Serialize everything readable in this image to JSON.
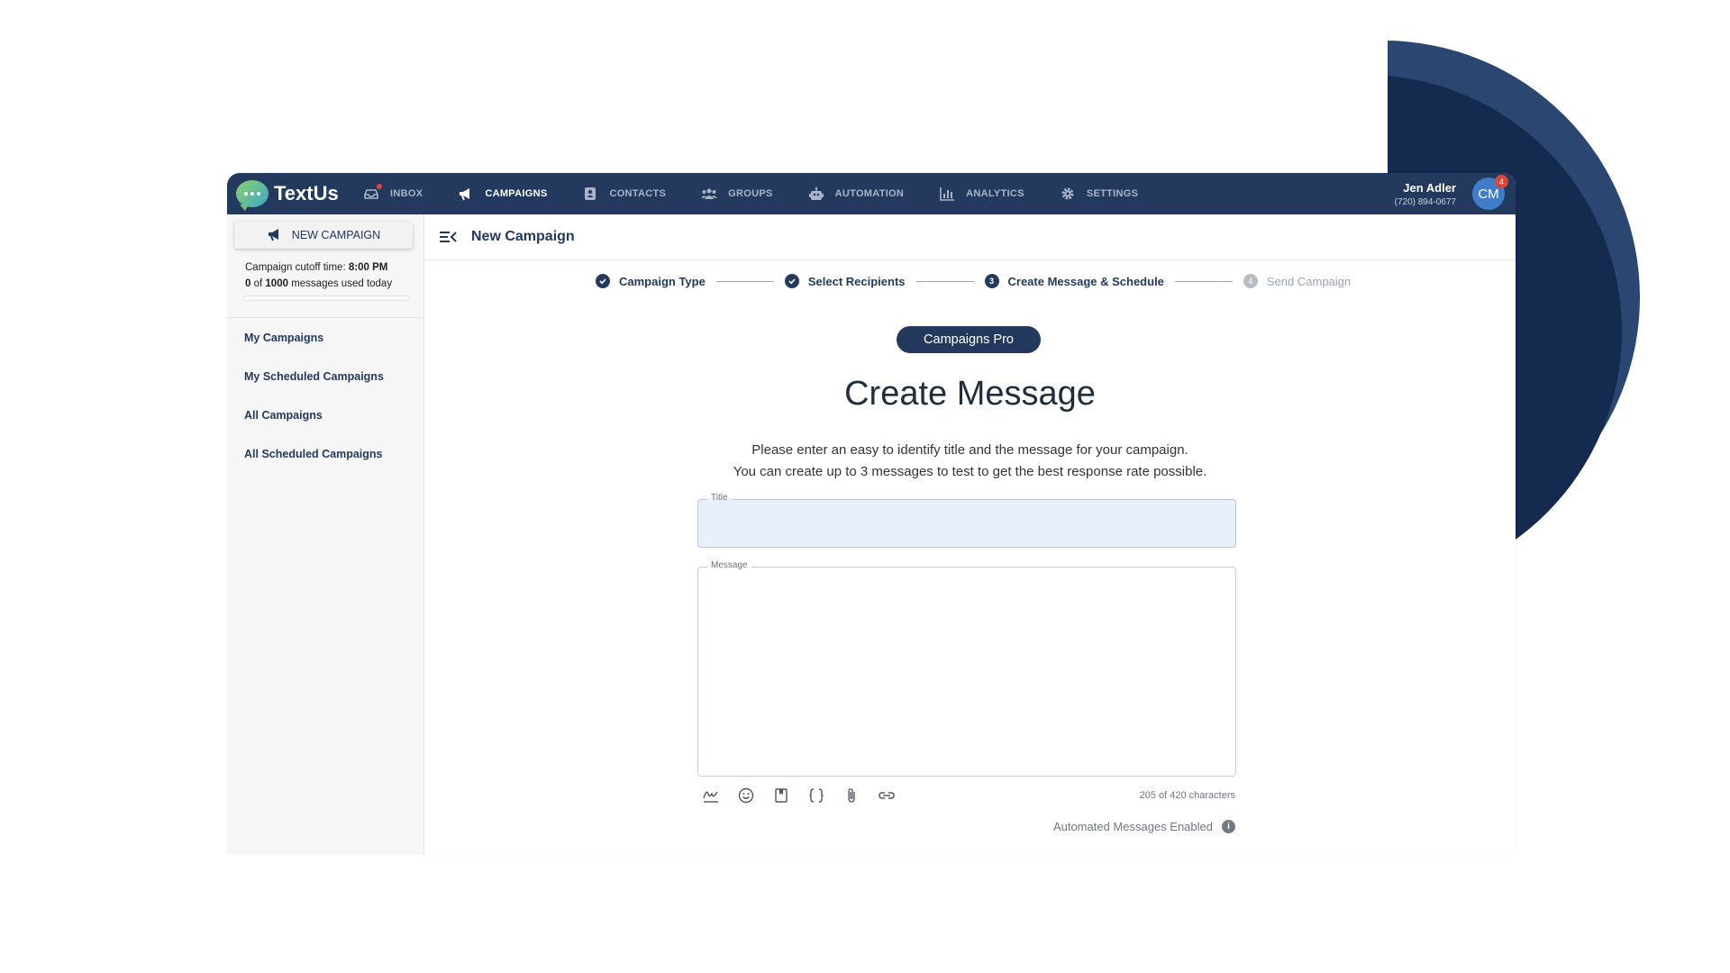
{
  "app": {
    "brand": "TextUs",
    "colors": {
      "navy": "#233a5e",
      "accent_blue": "#3f7cc9",
      "badge_red": "#d9473b"
    }
  },
  "nav": {
    "items": [
      {
        "label": "INBOX",
        "icon": "inbox-icon"
      },
      {
        "label": "CAMPAIGNS",
        "icon": "megaphone-icon",
        "active": true
      },
      {
        "label": "CONTACTS",
        "icon": "contacts-icon"
      },
      {
        "label": "GROUPS",
        "icon": "groups-icon"
      },
      {
        "label": "AUTOMATION",
        "icon": "robot-icon"
      },
      {
        "label": "ANALYTICS",
        "icon": "chart-icon"
      },
      {
        "label": "SETTINGS",
        "icon": "gear-icon"
      }
    ]
  },
  "user": {
    "name": "Jen Adler",
    "phone": "(720) 894-0677",
    "initials": "CM",
    "notifications": "4"
  },
  "sidebar": {
    "new_campaign_label": "NEW CAMPAIGN",
    "cutoff_prefix": "Campaign cutoff time:",
    "cutoff_time": "8:00 PM",
    "usage_used": "0",
    "usage_of": "of",
    "usage_total": "1000",
    "usage_suffix": "messages used today",
    "usage_fraction": 0,
    "links": [
      "My Campaigns",
      "My Scheduled Campaigns",
      "All Campaigns",
      "All Scheduled Campaigns"
    ]
  },
  "content": {
    "header_title": "New Campaign",
    "steps": [
      {
        "label": "Campaign Type",
        "state": "done"
      },
      {
        "label": "Select Recipients",
        "state": "done"
      },
      {
        "label": "Create Message & Schedule",
        "number": "3",
        "state": "current"
      },
      {
        "label": "Send Campaign",
        "number": "4",
        "state": "pending"
      }
    ],
    "pill": "Campaigns Pro",
    "heading": "Create Message",
    "desc_line1": "Please enter an easy to identify title and the message for your campaign.",
    "desc_line2": "You can create up to 3 messages to test to get the best response rate possible.",
    "title_label": "Title",
    "title_value": "",
    "message_label": "Message",
    "message_value": "",
    "char_count": "205 of 420 characters",
    "auto_messages": "Automated Messages Enabled",
    "info_glyph": "i"
  },
  "toolbar_icons": [
    "signature-icon",
    "emoji-icon",
    "template-icon",
    "variables-icon",
    "attachment-icon",
    "link-shortener-icon"
  ]
}
